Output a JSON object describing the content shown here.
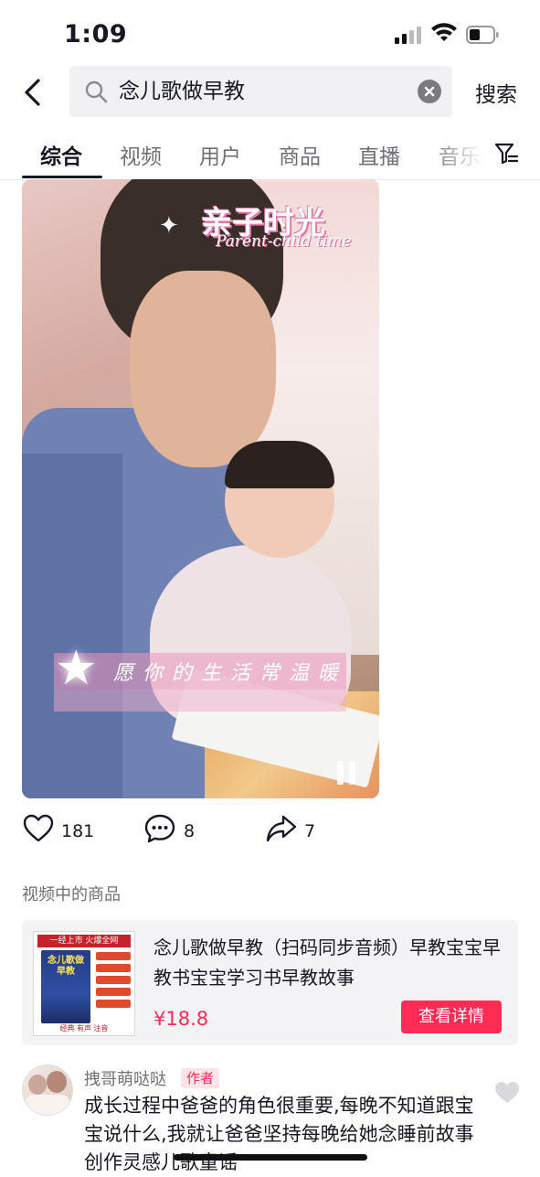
{
  "status_bar": {
    "time": "1:09"
  },
  "search": {
    "query": "念儿歌做早教",
    "submit_label": "搜索"
  },
  "tabs": [
    {
      "label": "综合",
      "active": true
    },
    {
      "label": "视频",
      "active": false
    },
    {
      "label": "用户",
      "active": false
    },
    {
      "label": "商品",
      "active": false
    },
    {
      "label": "直播",
      "active": false
    },
    {
      "label": "音乐",
      "active": false
    }
  ],
  "video": {
    "overlay_title": "亲子时光",
    "overlay_subtitle": "Parent-child time",
    "overlay_caption": "愿你的生活常温暖",
    "state": "playing"
  },
  "actions": {
    "likes": "181",
    "comments": "8",
    "shares": "7"
  },
  "products_section": {
    "label": "视频中的商品",
    "item": {
      "title": "念儿歌做早教（扫码同步音频）早教宝宝早教书宝宝学习书早教故事",
      "price": "¥18.8",
      "button_label": "查看详情",
      "thumbnail": {
        "header": "一经上市 火爆全网",
        "book_title": "念儿歌做早教",
        "footer": "经典 有声 注音"
      }
    }
  },
  "comment": {
    "username": "拽哥萌哒哒",
    "badge": "作者",
    "text": "成长过程中爸爸的角色很重要,每晚不知道跟宝宝说什么,我就让爸爸坚持每晚给她念睡前故事创作灵感儿歌童谣"
  },
  "icons": {
    "back": "chevron-left-icon",
    "search": "search-icon",
    "clear": "close-circle-icon",
    "filter": "filter-icon",
    "like": "heart-icon",
    "comment": "comment-bubble-icon",
    "share": "share-arrow-icon",
    "pause": "pause-icon",
    "comment_like": "heart-icon"
  },
  "colors": {
    "accent": "#fe2c55",
    "text_primary": "#161823",
    "text_secondary": "#6f7076",
    "card_bg": "#f3f3f5"
  }
}
